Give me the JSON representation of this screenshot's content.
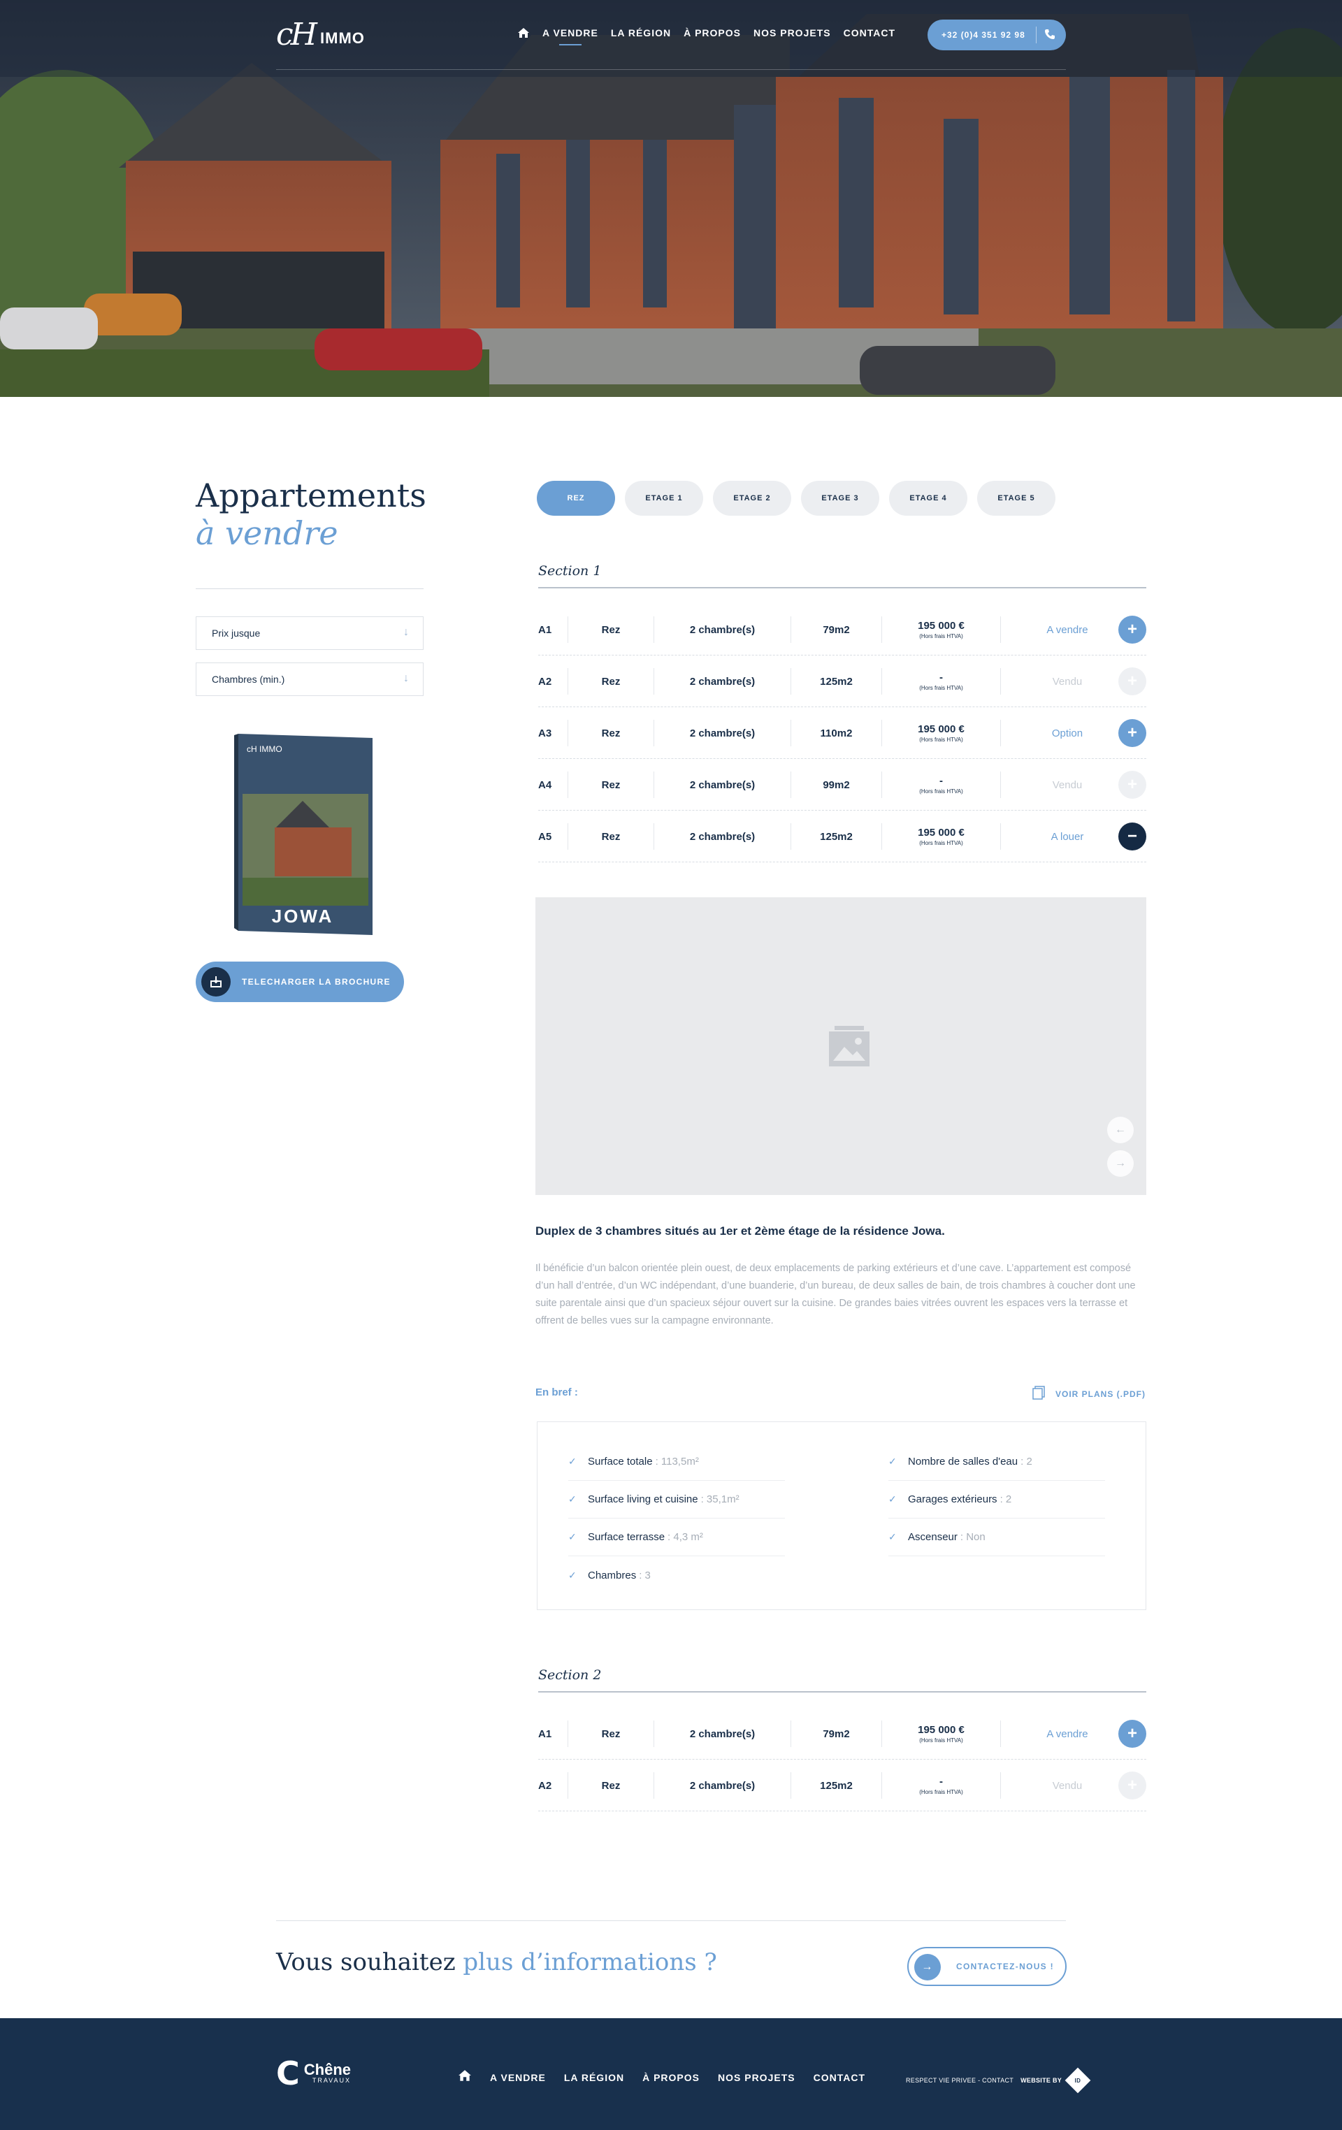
{
  "header": {
    "logo_mark": "cH",
    "logo_text": "IMMO",
    "nav": [
      "A VENDRE",
      "LA RÉGION",
      "À PROPOS",
      "NOS PROJETS",
      "CONTACT"
    ],
    "phone": "+32 (0)4 351 92 98"
  },
  "left": {
    "title_line1": "Appartements",
    "title_line2": "à vendre",
    "filter_price": "Prix jusque",
    "filter_rooms": "Chambres (min.)",
    "brochure_name": "JOWA",
    "brochure_logo": "cH IMMO",
    "download_label": "TELECHARGER LA BROCHURE"
  },
  "tabs": [
    "REZ",
    "ETAGE 1",
    "ETAGE 2",
    "ETAGE 3",
    "ETAGE 4",
    "ETAGE 5"
  ],
  "sections": [
    {
      "title": "Section 1",
      "rows": [
        {
          "lot": "A1",
          "floor": "Rez",
          "rooms": "2 chambre(s)",
          "area": "79m2",
          "price": "195 000 €",
          "price_note": "(Hors frais HTVA)",
          "status": "A vendre",
          "btn": "+"
        },
        {
          "lot": "A2",
          "floor": "Rez",
          "rooms": "2 chambre(s)",
          "area": "125m2",
          "price": "-",
          "price_note": "(Hors frais HTVA)",
          "status": "Vendu",
          "btn": "+"
        },
        {
          "lot": "A3",
          "floor": "Rez",
          "rooms": "2 chambre(s)",
          "area": "110m2",
          "price": "195 000 €",
          "price_note": "(Hors frais HTVA)",
          "status": "Option",
          "btn": "+"
        },
        {
          "lot": "A4",
          "floor": "Rez",
          "rooms": "2 chambre(s)",
          "area": "99m2",
          "price": "-",
          "price_note": "(Hors frais HTVA)",
          "status": "Vendu",
          "btn": "+"
        },
        {
          "lot": "A5",
          "floor": "Rez",
          "rooms": "2 chambre(s)",
          "area": "125m2",
          "price": "195 000 €",
          "price_note": "(Hors frais HTVA)",
          "status": "A louer",
          "btn": "−"
        }
      ]
    },
    {
      "title": "Section 2",
      "rows": [
        {
          "lot": "A1",
          "floor": "Rez",
          "rooms": "2 chambre(s)",
          "area": "79m2",
          "price": "195 000 €",
          "price_note": "(Hors frais HTVA)",
          "status": "A vendre",
          "btn": "+"
        },
        {
          "lot": "A2",
          "floor": "Rez",
          "rooms": "2 chambre(s)",
          "area": "125m2",
          "price": "-",
          "price_note": "(Hors frais HTVA)",
          "status": "Vendu",
          "btn": "+"
        }
      ]
    }
  ],
  "detail": {
    "title": "Duplex de 3 chambres situés au 1er et 2ème étage de la résidence Jowa.",
    "body": "Il bénéficie d’un balcon orientée plein ouest, de deux emplacements de parking extérieurs et d’une cave. L’appartement est composé d’un hall d’entrée, d’un WC indépendant, d’une buanderie, d’un bureau, de deux salles de bain, de trois chambres à coucher dont une suite parentale ainsi que d’un spacieux séjour ouvert sur la cuisine. De grandes baies vitrées ouvrent les espaces vers la terrasse et offrent de belles vues sur la campagne environnante.",
    "bref_label": "En bref :",
    "plans_label": "VOIR PLANS (.PDF)",
    "specs_left": [
      {
        "label": "Surface totale",
        "value": ": 113,5m²"
      },
      {
        "label": "Surface living et cuisine",
        "value": ": 35,1m²"
      },
      {
        "label": "Surface terrasse",
        "value": ": 4,3 m²"
      },
      {
        "label": "Chambres",
        "value": ": 3"
      }
    ],
    "specs_right": [
      {
        "label": "Nombre de salles d'eau",
        "value": ": 2"
      },
      {
        "label": "Garages extérieurs",
        "value": ": 2"
      },
      {
        "label": "Ascenseur",
        "value": ": Non"
      }
    ]
  },
  "cta": {
    "text_plain": "Vous souhaitez ",
    "text_accent": "plus d’informations ?",
    "button": "CONTACTEZ-NOUS !"
  },
  "footer": {
    "logo_letter": "C",
    "logo_name": "Chêne",
    "logo_sub": "TRAVAUX",
    "nav": [
      "A VENDRE",
      "LA RÉGION",
      "À PROPOS",
      "NOS PROJETS",
      "CONTACT"
    ],
    "legal": "RESPECT VIE PRIVEE - CONTACT",
    "website_by": "WEBSITE BY",
    "badge": "ID"
  },
  "colors": {
    "accent": "#6b9fd4",
    "navy": "#1a2f49",
    "footer": "#18304d"
  }
}
